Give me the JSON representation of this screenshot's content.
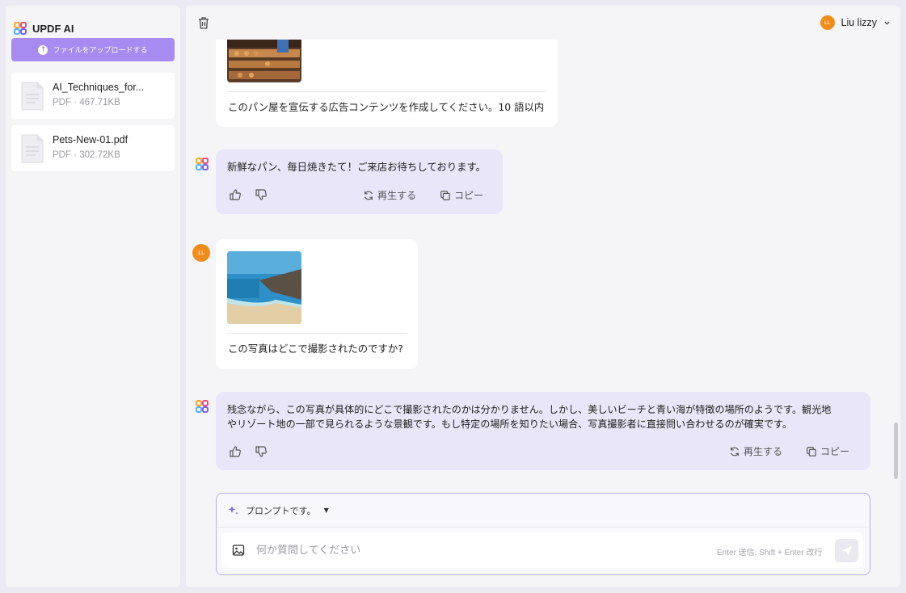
{
  "app": {
    "brand": "UPDF AI"
  },
  "sidebar": {
    "upload_label": "ファイルをアップロードする",
    "files": [
      {
        "name": "AI_Techniques_for...",
        "meta": "PDF · 467.71KB"
      },
      {
        "name": "Pets-New-01.pdf",
        "meta": "PDF · 302.72KB"
      }
    ]
  },
  "header": {
    "user_initials": "LL",
    "user_name": "Liu lizzy"
  },
  "chat": {
    "user_avatar_initials": "LL",
    "messages": [
      {
        "role": "user",
        "text": "このパン屋を宣伝する広告コンテンツを作成してください。10 語以内"
      },
      {
        "role": "assistant",
        "text": "新鮮なパン、毎日焼きたて！ご来店お待ちしております。",
        "regenerate": "再生する",
        "copy": "コピー"
      },
      {
        "role": "user",
        "text": "この写真はどこで撮影されたのですか?"
      },
      {
        "role": "assistant",
        "text_line1": "残念ながら、この写真が具体的にどこで撮影されたのかは分かりません。しかし、美しいビーチと青い海が特徴の場所のようです。観光地",
        "text_line2": "やリゾート地の一部で見られるような景観です。もし特定の場所を知りたい場合、写真撮影者に直接問い合わせるのが確実です。",
        "regenerate": "再生する",
        "copy": "コピー"
      }
    ]
  },
  "composer": {
    "prompt_label": "プロンプトです。",
    "placeholder": "何か質問してください",
    "hint": "Enter 送信; Shift + Enter 改行"
  },
  "colors": {
    "accent": "#a78bf0",
    "avatar": "#f28c19",
    "ai_bubble": "#e8e6f8"
  }
}
